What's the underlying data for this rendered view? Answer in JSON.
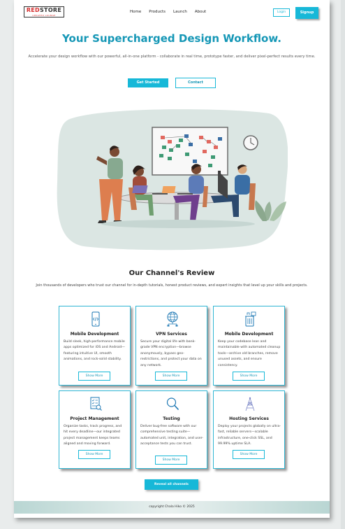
{
  "header": {
    "logo_brand_red": "RED",
    "logo_brand_dark": "STORE",
    "logo_tagline": "UPDATED LOUNGE",
    "nav": [
      "Home",
      "Products",
      "Launch",
      "About"
    ],
    "login_label": "Login",
    "signup_label": "Signup"
  },
  "hero": {
    "title": "Your Supercharged Design Workflow.",
    "subtitle": "Accelerate your design workflow with our powerful, all-in-one platform - collaborate in real time, prototype faster, and deliver pixel-perfect results every time.",
    "cta_primary": "Get Started",
    "cta_secondary": "Contact"
  },
  "review": {
    "title": "Our Channel's Review",
    "subtitle": "Join thousands of developers who trust our channel for in-depth tutorials, honest product reviews, and expert insights that level up your skills and projects.",
    "cards": [
      {
        "icon": "smartphone-code-icon",
        "title": "Mobile Development",
        "description": "Build sleek, high-performance mobile apps optimized for iOS and Android—featuring intuitive UI, smooth animations, and rock-solid stability.",
        "button": "Show More"
      },
      {
        "icon": "globe-network-icon",
        "title": "VPN Services",
        "description": "Secure your digital life with bank-grade VPN encryption—browse anonymously, bypass geo-restrictions, and protect your data on any network.",
        "button": "Show More"
      },
      {
        "icon": "trash-clean-icon",
        "title": "Mobile Development",
        "description": "Keep your codebase lean and maintainable with automated cleanup tools—archive old branches, remove unused assets, and ensure consistency.",
        "button": "Show More"
      },
      {
        "icon": "checklist-search-icon",
        "title": "Project Management",
        "description": "Organize tasks, track progress, and hit every deadline—our integrated project management keeps teams aligned and moving forward.",
        "button": "Show More"
      },
      {
        "icon": "magnifier-icon",
        "title": "Testing",
        "description": "Deliver bug-free software with our comprehensive testing suite—automated unit, integration, and user-acceptance tests you can trust.",
        "button": "Show More"
      },
      {
        "icon": "antenna-tower-icon",
        "title": "Hosting Services",
        "description": "Deploy your projects globally on ultra-fast, reliable servers—scalable infrastructure, one-click SSL, and 99.99% uptime SLA.",
        "button": "Show More"
      }
    ],
    "reveal_label": "Reveal all channels"
  },
  "footer": {
    "copyright": "copyright Chala Hiko © 2025"
  },
  "colors": {
    "accent": "#17b8d8",
    "title": "#1597b6",
    "logo_red": "#d62f2f"
  }
}
